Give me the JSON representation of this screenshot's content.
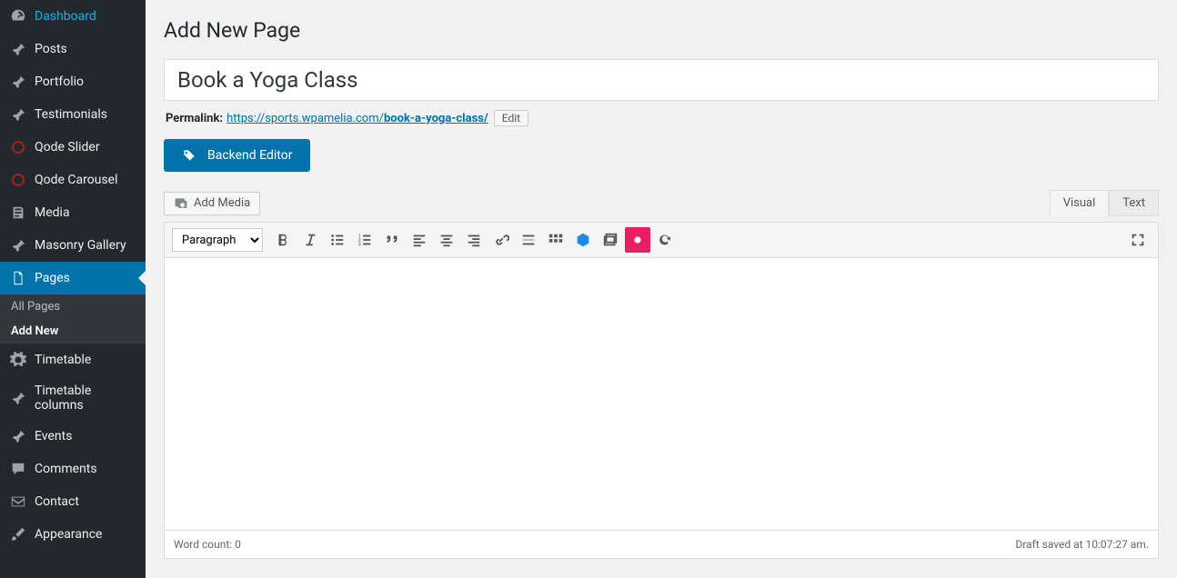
{
  "sidebar": {
    "items": [
      {
        "label": "Dashboard",
        "name": "dashboard"
      },
      {
        "label": "Posts",
        "name": "posts"
      },
      {
        "label": "Portfolio",
        "name": "portfolio"
      },
      {
        "label": "Testimonials",
        "name": "testimonials"
      },
      {
        "label": "Qode Slider",
        "name": "qode-slider"
      },
      {
        "label": "Qode Carousel",
        "name": "qode-carousel"
      },
      {
        "label": "Media",
        "name": "media"
      },
      {
        "label": "Masonry Gallery",
        "name": "masonry-gallery"
      },
      {
        "label": "Pages",
        "name": "pages"
      },
      {
        "label": "Timetable",
        "name": "timetable"
      },
      {
        "label": "Timetable columns",
        "name": "timetable-columns"
      },
      {
        "label": "Events",
        "name": "events"
      },
      {
        "label": "Comments",
        "name": "comments"
      },
      {
        "label": "Contact",
        "name": "contact"
      },
      {
        "label": "Appearance",
        "name": "appearance"
      }
    ],
    "submenu": {
      "allPages": "All Pages",
      "addNew": "Add New"
    }
  },
  "page": {
    "heading": "Add New Page",
    "title": "Book a Yoga Class",
    "permalinkLabel": "Permalink:",
    "permalinkBase": "https://sports.wpamelia.com/",
    "permalinkSlug": "book-a-yoga-class/",
    "editBtn": "Edit",
    "backendEditor": "Backend Editor",
    "addMedia": "Add Media",
    "tabVisual": "Visual",
    "tabText": "Text",
    "formatSelect": "Paragraph",
    "wordCount": "Word count: 0",
    "draftSaved": "Draft saved at 10:07:27 am."
  }
}
